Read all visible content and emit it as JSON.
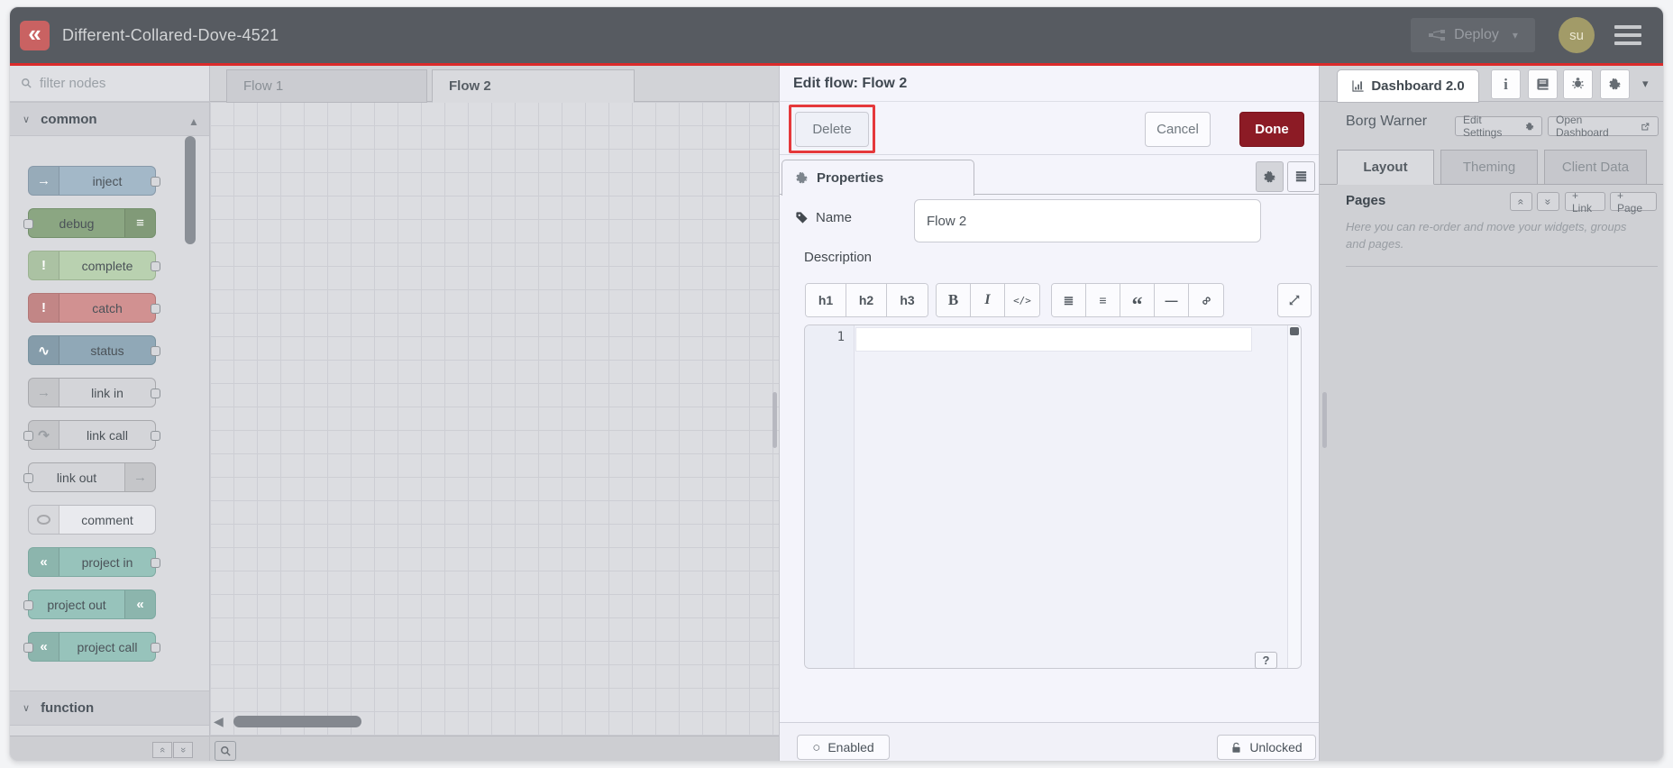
{
  "header": {
    "title": "Different-Collared-Dove-4521",
    "deploy_label": "Deploy",
    "avatar_initials": "su"
  },
  "palette": {
    "filter_placeholder": "filter nodes",
    "categories": [
      {
        "label": "common"
      },
      {
        "label": "function"
      }
    ],
    "nodes": [
      {
        "label": "inject",
        "bg": "#a3b8c8",
        "border": "#8799a9",
        "icon": "arrow-right-icon",
        "glyph": "→",
        "icon_pos": "left",
        "icon_fg": "#ffffff",
        "ports": "right"
      },
      {
        "label": "debug",
        "bg": "#8ba682",
        "border": "#74906c",
        "icon": "lines-icon",
        "glyph": "≡",
        "icon_pos": "right",
        "icon_fg": "#ffffff",
        "ports": "left"
      },
      {
        "label": "complete",
        "bg": "#b9d1b0",
        "border": "#9cb392",
        "icon": "exclamation-icon",
        "glyph": "!",
        "icon_pos": "left",
        "icon_fg": "#ffffff",
        "ports": "right"
      },
      {
        "label": "catch",
        "bg": "#d19191",
        "border": "#b27777",
        "icon": "exclamation-icon",
        "glyph": "!",
        "icon_pos": "left",
        "icon_fg": "#ffffff",
        "ports": "right"
      },
      {
        "label": "status",
        "bg": "#90a8b7",
        "border": "#78929f",
        "icon": "pulse-icon",
        "glyph": "∿",
        "icon_pos": "left",
        "icon_fg": "#ffffff",
        "ports": "right"
      },
      {
        "label": "link in",
        "bg": "#d4d5d9",
        "border": "#a8a9ad",
        "icon": "link-arrow-icon",
        "glyph": "→",
        "icon_pos": "left",
        "icon_fg": "#9a9ea3",
        "ports": "right"
      },
      {
        "label": "link call",
        "bg": "#d4d5d9",
        "border": "#a8a9ad",
        "icon": "link-call-icon",
        "glyph": "↷",
        "icon_pos": "left",
        "icon_fg": "#9a9ea3",
        "ports": "both"
      },
      {
        "label": "link out",
        "bg": "#d4d5d9",
        "border": "#a8a9ad",
        "icon": "link-arrow-icon",
        "glyph": "→",
        "icon_pos": "right",
        "icon_fg": "#9a9ea3",
        "ports": "left"
      },
      {
        "label": "comment",
        "bg": "#e9eaee",
        "border": "#b9bac0",
        "icon": "speech-bubble-icon",
        "glyph": "",
        "icon_pos": "left",
        "icon_fg": "#a6a7ab",
        "ports": "none",
        "bubble": true
      },
      {
        "label": "project in",
        "bg": "#97c3bb",
        "border": "#7da9a1",
        "icon": "project-logo-icon",
        "glyph": "«",
        "icon_pos": "left",
        "icon_fg": "#ffffff",
        "ports": "right"
      },
      {
        "label": "project out",
        "bg": "#97c3bb",
        "border": "#7da9a1",
        "icon": "project-logo-icon",
        "glyph": "«",
        "icon_pos": "right",
        "icon_fg": "#ffffff",
        "ports": "left"
      },
      {
        "label": "project call",
        "bg": "#97c3bb",
        "border": "#7da9a1",
        "icon": "project-logo-icon",
        "glyph": "«",
        "icon_pos": "left",
        "icon_fg": "#ffffff",
        "ports": "both"
      }
    ]
  },
  "workspace": {
    "tabs": [
      {
        "label": "Flow 1"
      },
      {
        "label": "Flow 2"
      }
    ]
  },
  "edit_panel": {
    "title": "Edit flow: Flow 2",
    "delete_label": "Delete",
    "cancel_label": "Cancel",
    "done_label": "Done",
    "properties_tab": "Properties",
    "name_label": "Name",
    "name_value": "Flow 2",
    "description_label": "Description",
    "toolbar": {
      "h1": "h1",
      "h2": "h2",
      "h3": "h3",
      "bold": "B",
      "italic": "I",
      "code": "</>"
    },
    "editor": {
      "line_number": "1",
      "help_label": "?"
    },
    "footer": {
      "enabled_label": "Enabled",
      "locked_label": "Unlocked"
    }
  },
  "sidebar": {
    "tab_label": "Dashboard 2.0",
    "owner": "Borg Warner",
    "edit_settings_label": "Edit Settings",
    "open_dashboard_label": "Open Dashboard",
    "tabs": [
      {
        "label": "Layout"
      },
      {
        "label": "Theming"
      },
      {
        "label": "Client Data"
      }
    ],
    "pages_heading": "Pages",
    "link_button": "+ Link",
    "page_button": "+ Page",
    "helper_text": "Here you can re-order and move your widgets, groups and pages."
  },
  "icons": {
    "category_chevron": "∨",
    "caret_down": "▾",
    "scroll_up": "▲",
    "scroll_down": "▼",
    "scroll_left": "◀",
    "double_chevron": "«",
    "double_chevron_r": "»",
    "ordered_list": "≣",
    "unordered_list": "≡",
    "quote": "“",
    "hr": "—",
    "link": "∞",
    "enabled_circle": "○",
    "info": "i"
  },
  "colors": {
    "header_bg": "#575b61",
    "accent_red_line": "#db2b2b",
    "done_button_red": "#8c1b25",
    "annotation_red": "#e5383b",
    "avatar_olive": "#a29b68"
  }
}
